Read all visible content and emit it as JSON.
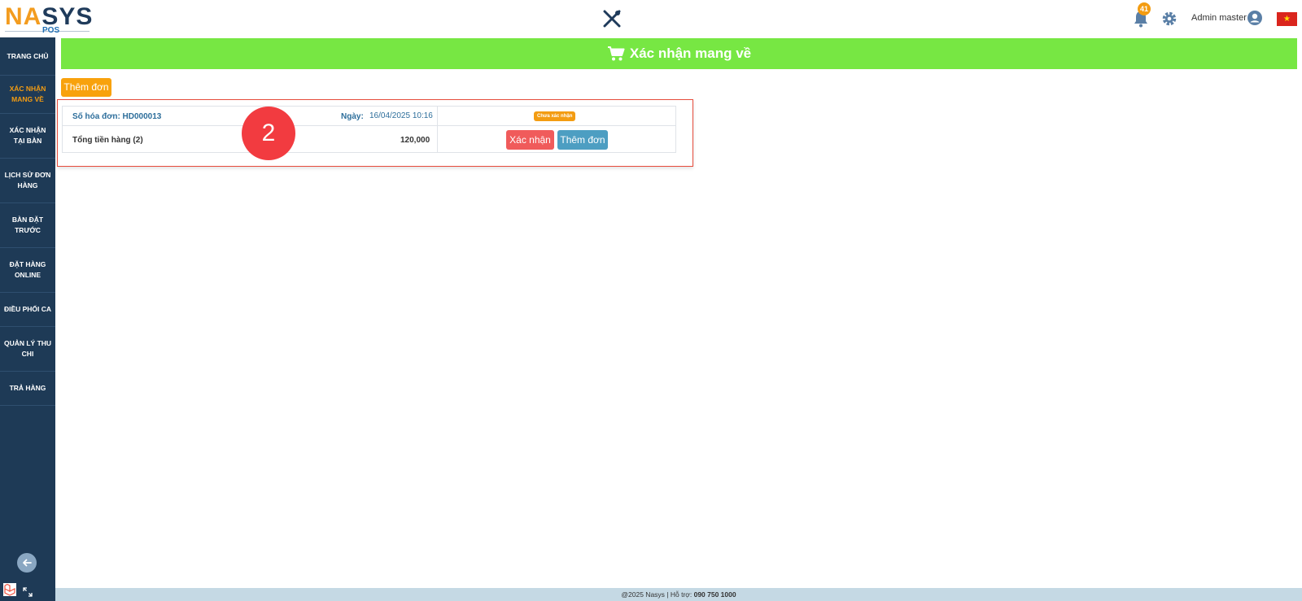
{
  "header": {
    "logo_word_na": "NA",
    "logo_word_sys": "SYS",
    "logo_pos": "POS",
    "notification_count": "41",
    "user_name": "Admin master"
  },
  "sidebar": {
    "items": [
      {
        "label": "TRANG CHỦ"
      },
      {
        "label": "XÁC NHẬN MANG VỀ"
      },
      {
        "label": "XÁC NHẬN TẠI BÀN"
      },
      {
        "label": "LỊCH SỬ ĐƠN HÀNG"
      },
      {
        "label": "BÀN ĐẶT TRƯỚC"
      },
      {
        "label": "ĐẶT HÀNG ONLINE"
      },
      {
        "label": "ĐIỀU PHỐI CA"
      },
      {
        "label": "QUẢN LÝ THU CHI"
      },
      {
        "label": "TRẢ HÀNG"
      }
    ],
    "active_index": 1
  },
  "main": {
    "title": "Xác nhận mang về",
    "add_order_label": "Thêm đơn",
    "order": {
      "invoice_label": "Số hóa đơn: HD000013",
      "date_label": "Ngày:",
      "date_value": "16/04/2025 10:16",
      "total_label": "Tổng tiền hàng (2)",
      "total_value": "120,000",
      "status": "Chưa xác nhận",
      "confirm_label": "Xác nhận",
      "add_label": "Thêm đơn"
    },
    "step_marker": "2"
  },
  "footer": {
    "copyright": "@2025 Nasys | Hỗ trợ:",
    "phone": "090 750 1000"
  },
  "colors": {
    "sidebar_bg": "#1e3a56",
    "title_bar": "#77e743",
    "accent_orange": "#f39c12",
    "confirm_red": "#f05b5b",
    "add_blue": "#4d9ec2"
  }
}
